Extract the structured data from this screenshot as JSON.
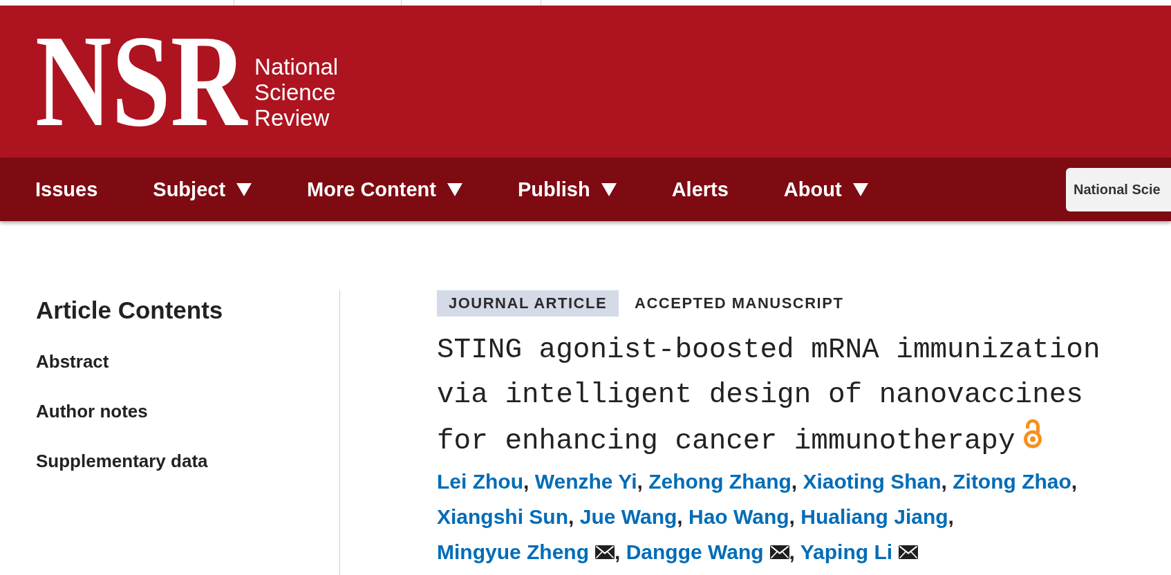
{
  "header": {
    "logo_mark": "NSR",
    "journal_name": [
      "National",
      "Science",
      "Review"
    ]
  },
  "nav": {
    "items": [
      {
        "label": "Issues",
        "dropdown": false
      },
      {
        "label": "Subject",
        "dropdown": true
      },
      {
        "label": "More Content",
        "dropdown": true
      },
      {
        "label": "Publish",
        "dropdown": true
      },
      {
        "label": "Alerts",
        "dropdown": false
      },
      {
        "label": "About",
        "dropdown": true
      }
    ],
    "search_scope": {
      "value": "National Scie"
    }
  },
  "sidebar": {
    "title": "Article Contents",
    "items": [
      "Abstract",
      "Author notes",
      "Supplementary data"
    ]
  },
  "article": {
    "labels": [
      {
        "text": "JOURNAL ARTICLE",
        "kind": "badge"
      },
      {
        "text": "ACCEPTED MANUSCRIPT",
        "kind": "plain"
      }
    ],
    "title": "STING agonist-boosted mRNA immunization via intelligent design of nanovaccines for enhancing cancer immunotherapy",
    "open_access": true,
    "authors": [
      {
        "name": "Lei Zhou",
        "corresponding": false,
        "separator": ","
      },
      {
        "name": "Wenzhe Yi",
        "corresponding": false,
        "separator": ","
      },
      {
        "name": "Zehong Zhang",
        "corresponding": false,
        "separator": ","
      },
      {
        "name": "Xiaoting Shan",
        "corresponding": false,
        "separator": ","
      },
      {
        "name": "Zitong Zhao",
        "corresponding": false,
        "separator": ","
      },
      {
        "name": "Xiangshi Sun",
        "corresponding": false,
        "separator": ","
      },
      {
        "name": "Jue Wang",
        "corresponding": false,
        "separator": ","
      },
      {
        "name": "Hao Wang",
        "corresponding": false,
        "separator": ","
      },
      {
        "name": "Hualiang Jiang",
        "corresponding": false,
        "separator": ","
      },
      {
        "name": "Mingyue Zheng",
        "corresponding": true,
        "separator": ","
      },
      {
        "name": "Dangge Wang",
        "corresponding": true,
        "separator": ","
      },
      {
        "name": "Yaping Li",
        "corresponding": true
      }
    ]
  }
}
